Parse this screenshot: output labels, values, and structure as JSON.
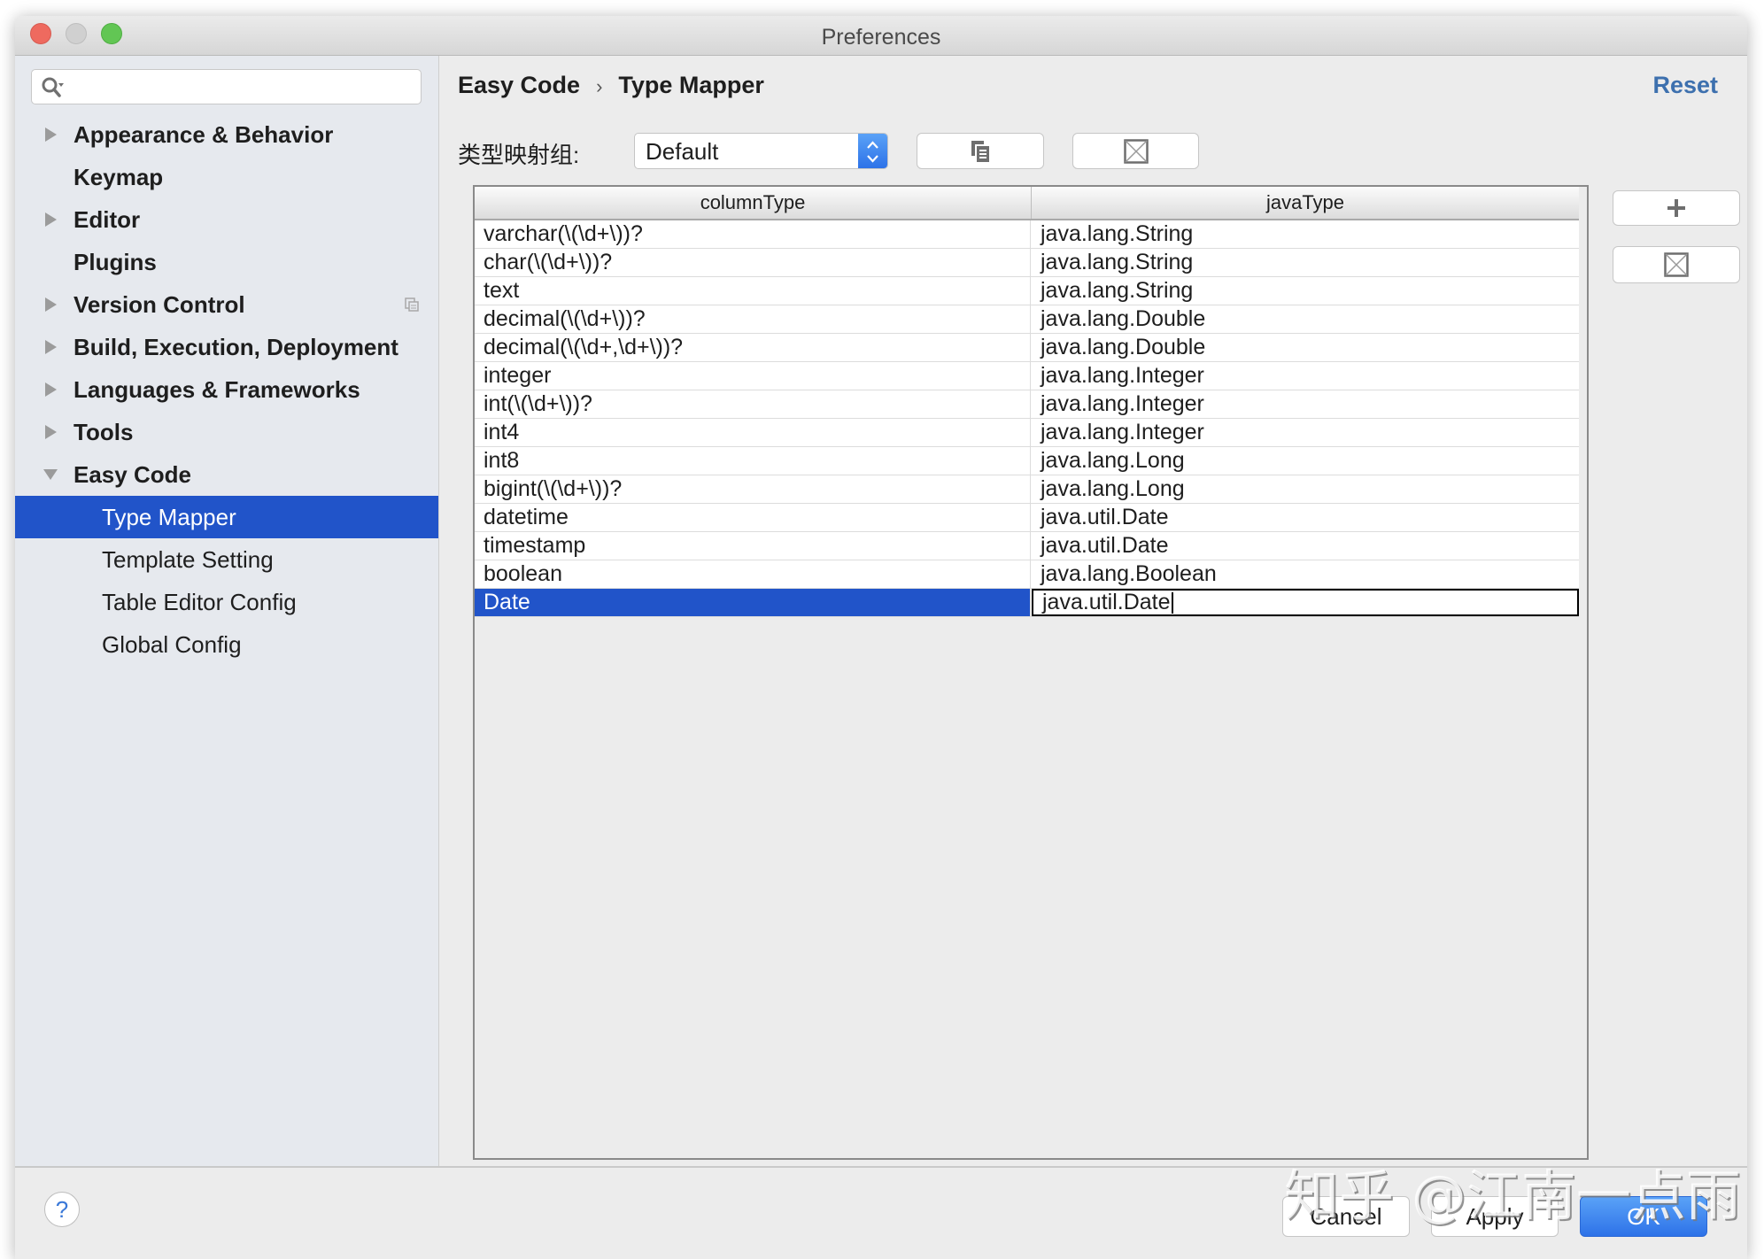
{
  "window": {
    "title": "Preferences"
  },
  "sidebar": {
    "search": {
      "placeholder": "",
      "value": ""
    },
    "items": [
      {
        "label": "Appearance & Behavior",
        "expandable": true,
        "expanded": false,
        "level": 0
      },
      {
        "label": "Keymap",
        "expandable": false,
        "level": 0
      },
      {
        "label": "Editor",
        "expandable": true,
        "expanded": false,
        "level": 0
      },
      {
        "label": "Plugins",
        "expandable": false,
        "level": 0
      },
      {
        "label": "Version Control",
        "expandable": true,
        "expanded": false,
        "level": 0,
        "icon": "project-settings-icon"
      },
      {
        "label": "Build, Execution, Deployment",
        "expandable": true,
        "expanded": false,
        "level": 0
      },
      {
        "label": "Languages & Frameworks",
        "expandable": true,
        "expanded": false,
        "level": 0
      },
      {
        "label": "Tools",
        "expandable": true,
        "expanded": false,
        "level": 0
      },
      {
        "label": "Easy Code",
        "expandable": true,
        "expanded": true,
        "level": 0
      },
      {
        "label": "Type Mapper",
        "level": 1,
        "selected": true
      },
      {
        "label": "Template Setting",
        "level": 1
      },
      {
        "label": "Table Editor Config",
        "level": 1
      },
      {
        "label": "Global Config",
        "level": 1
      }
    ]
  },
  "content": {
    "breadcrumb": {
      "parent": "Easy Code",
      "separator": "›",
      "current": "Type Mapper"
    },
    "reset_label": "Reset",
    "group_label": "类型映射组:",
    "group_select": {
      "value": "Default"
    },
    "toolbar_icons": {
      "copy": "copy-icon",
      "delete": "delete-icon"
    },
    "side_buttons": {
      "add": "+",
      "remove": "remove-icon"
    },
    "table": {
      "columns": [
        "columnType",
        "javaType"
      ],
      "rows": [
        [
          "varchar(\\(\\d+\\))?",
          "java.lang.String"
        ],
        [
          "char(\\(\\d+\\))?",
          "java.lang.String"
        ],
        [
          "text",
          "java.lang.String"
        ],
        [
          "decimal(\\(\\d+\\))?",
          "java.lang.Double"
        ],
        [
          "decimal(\\(\\d+,\\d+\\))?",
          "java.lang.Double"
        ],
        [
          "integer",
          "java.lang.Integer"
        ],
        [
          "int(\\(\\d+\\))?",
          "java.lang.Integer"
        ],
        [
          "int4",
          "java.lang.Integer"
        ],
        [
          "int8",
          "java.lang.Long"
        ],
        [
          "bigint(\\(\\d+\\))?",
          "java.lang.Long"
        ],
        [
          "datetime",
          "java.util.Date"
        ],
        [
          "timestamp",
          "java.util.Date"
        ],
        [
          "boolean",
          "java.lang.Boolean"
        ],
        [
          "Date",
          "java.util.Date"
        ]
      ],
      "selected_row": 13,
      "editing_cell": {
        "row": 13,
        "column": "javaType",
        "value": "java.util.Date"
      }
    }
  },
  "footer": {
    "help_label": "?",
    "cancel_label": "Cancel",
    "apply_label": "Apply",
    "ok_label": "OK"
  },
  "watermark": "知乎 @江南一点雨",
  "colors": {
    "selection": "#2154c9",
    "link": "#3d70ae",
    "primary_button": "#2d72e8"
  }
}
